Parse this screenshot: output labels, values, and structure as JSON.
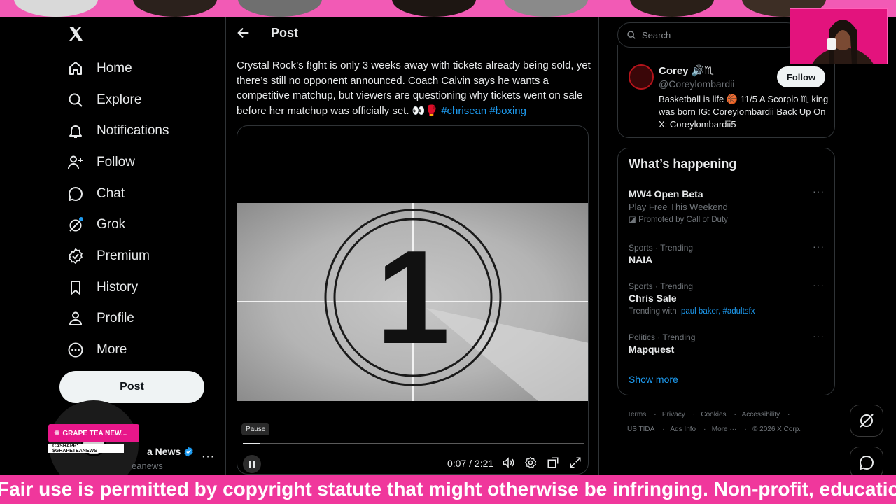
{
  "nav": {
    "items": [
      {
        "label": "Home",
        "icon": "home-icon"
      },
      {
        "label": "Explore",
        "icon": "search-icon"
      },
      {
        "label": "Notifications",
        "icon": "bell-icon"
      },
      {
        "label": "Follow",
        "icon": "add-user-icon"
      },
      {
        "label": "Chat",
        "icon": "chat-icon"
      },
      {
        "label": "Grok",
        "icon": "grok-icon"
      },
      {
        "label": "Premium",
        "icon": "verified-icon"
      },
      {
        "label": "History",
        "icon": "bookmark-icon"
      },
      {
        "label": "Profile",
        "icon": "person-icon"
      },
      {
        "label": "More",
        "icon": "more-circle-icon"
      }
    ],
    "post_button": "Post"
  },
  "account": {
    "name": "a News",
    "handle": "eanews",
    "more": "···"
  },
  "overlay": {
    "badge": "GRAPE TEA NEW...",
    "badge_sub": "CASHAPP: $GRAPETEANEWS"
  },
  "post": {
    "header_title": "Post",
    "text": "Crystal Rock’s f!ght is only 3 weeks away with tickets already being sold, yet there’s still no opponent announced. Coach Calvin says he wants a competitive matchup, but viewers are questioning why tickets went on sale before her matchup was officially set. 👀🥊 ",
    "hashtags": [
      "#chrisean",
      "#boxing"
    ],
    "video": {
      "countdown_number": "1",
      "tooltip": "Pause",
      "time": "0:07 / 2:21",
      "progress": 0.05
    }
  },
  "search": {
    "placeholder": "Search"
  },
  "profile_card": {
    "name": "Corey 🔊♏",
    "handle": "@Coreylombardii",
    "follow_label": "Follow",
    "bio": "Basketball is life 🏀 11/5 A Scorpio ♏ king was born IG: Coreylombardii Back Up On X: Coreylombardii5"
  },
  "whats_happening": {
    "title": "What’s happening",
    "trends": [
      {
        "meta": "",
        "title": "MW4 Open Beta",
        "sub": "Play Free This Weekend",
        "promo": "Promoted by Call of Duty"
      },
      {
        "meta": "Sports · Trending",
        "title": "NAIA",
        "sub": "",
        "promo": ""
      },
      {
        "meta": "Sports · Trending",
        "title": "Chris Sale",
        "sub": "Trending with",
        "links": "paul baker, #adultsfx",
        "promo": ""
      },
      {
        "meta": "Politics · Trending",
        "title": "Mapquest",
        "sub": "",
        "promo": ""
      }
    ],
    "show_more": "Show more",
    "more": "···"
  },
  "footer": {
    "line1": [
      "Terms",
      "Privacy",
      "Cookies",
      "Accessibility"
    ],
    "line2": [
      "US TIDA",
      "Ads Info",
      "More ···",
      "© 2026 X Corp."
    ]
  },
  "ticker": "Fair use is permitted by copyright statute that might otherwise be infringing. Non-profit, educational",
  "colors": {
    "accent": "#1d9bf0",
    "background": "#000000",
    "overlay_pink": "#f0379c"
  }
}
